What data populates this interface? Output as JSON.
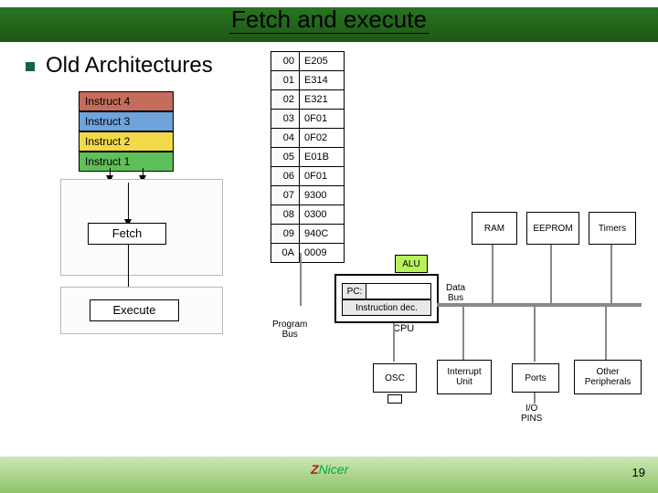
{
  "title": "Fetch and execute",
  "heading": "Old Architectures",
  "instructions": {
    "i4": "Instruct 4",
    "i3": "Instruct 3",
    "i2": "Instruct 2",
    "i1": "Instruct 1"
  },
  "stages": {
    "fetch": "Fetch",
    "execute": "Execute"
  },
  "memory": [
    {
      "addr": "00",
      "val": "E205"
    },
    {
      "addr": "01",
      "val": "E314"
    },
    {
      "addr": "02",
      "val": "E321"
    },
    {
      "addr": "03",
      "val": "0F01"
    },
    {
      "addr": "04",
      "val": "0F02"
    },
    {
      "addr": "05",
      "val": "E01B"
    },
    {
      "addr": "06",
      "val": "0F01"
    },
    {
      "addr": "07",
      "val": "9300"
    },
    {
      "addr": "08",
      "val": "0300"
    },
    {
      "addr": "09",
      "val": "940C"
    },
    {
      "addr": "0A",
      "val": "0009"
    }
  ],
  "cpu": {
    "alu": "ALU",
    "pc": "PC:",
    "instrdec": "Instruction dec.",
    "cpu": "CPU",
    "databus": "Data\nBus",
    "programbus": "Program\nBus",
    "ram": "RAM",
    "eeprom": "EEPROM",
    "timers": "Timers",
    "osc": "OSC",
    "interrupt": "Interrupt\nUnit",
    "ports": "Ports",
    "other": "Other\nPeripherals",
    "iopins": "I/O\nPINS"
  },
  "footer": {
    "page": "19",
    "logo_z": "Z",
    "logo_nicer": "Nicer"
  }
}
